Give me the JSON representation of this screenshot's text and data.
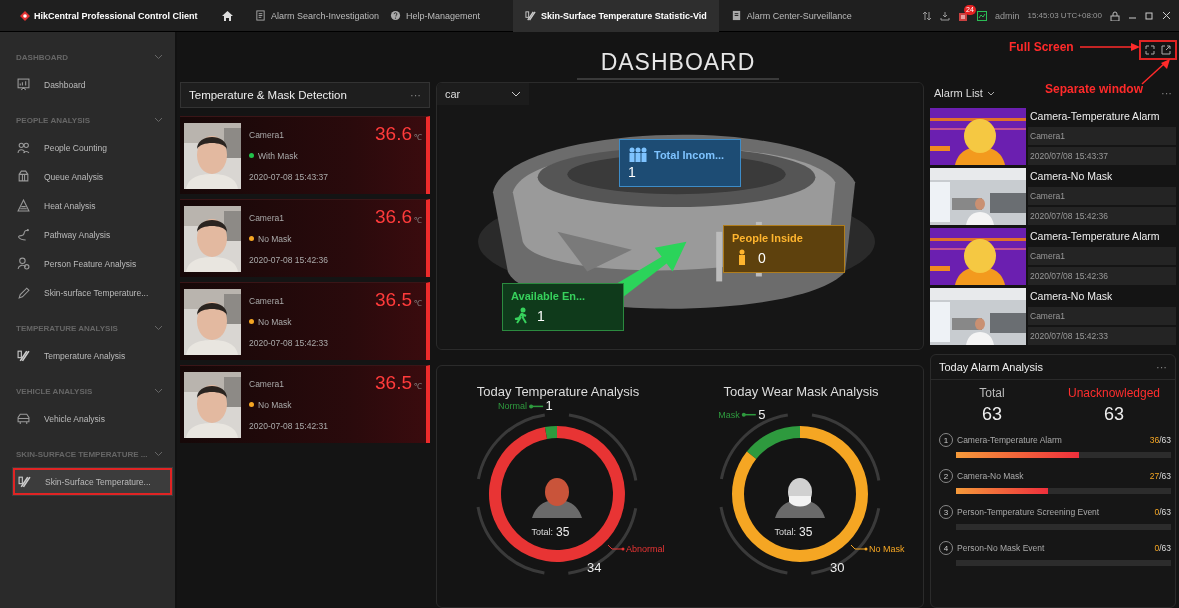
{
  "title_bar": {
    "app_name": "HikCentral Professional Control Client",
    "tabs": [
      {
        "label": "Alarm Search-Investigation",
        "selected": false
      },
      {
        "label": "Help-Management",
        "selected": false
      },
      {
        "label": "Skin-Surface Temperature Statistic-Vid",
        "selected": true
      },
      {
        "label": "Alarm Center-Surveillance",
        "selected": false
      }
    ],
    "badge": "24",
    "user": "admin",
    "time": "15:45:03 UTC+08:00"
  },
  "sidebar": {
    "sections": [
      {
        "title": "DASHBOARD",
        "expanded": true,
        "items": [
          {
            "label": "Dashboard",
            "selected": false
          }
        ]
      },
      {
        "title": "PEOPLE ANALYSIS",
        "expanded": true,
        "items": [
          {
            "label": "People Counting",
            "selected": false
          },
          {
            "label": "Queue Analysis",
            "selected": false
          },
          {
            "label": "Heat Analysis",
            "selected": false
          },
          {
            "label": "Pathway Analysis",
            "selected": false
          },
          {
            "label": "Person Feature Analysis",
            "selected": false
          },
          {
            "label": "Skin-surface Temperature...",
            "selected": false
          }
        ]
      },
      {
        "title": "TEMPERATURE ANALYSIS",
        "expanded": true,
        "items": [
          {
            "label": "Temperature Analysis",
            "selected": false
          }
        ]
      },
      {
        "title": "VEHICLE ANALYSIS",
        "expanded": true,
        "items": [
          {
            "label": "Vehicle Analysis",
            "selected": false
          }
        ]
      },
      {
        "title": "SKIN-SURFACE TEMPERATURE ...",
        "expanded": true,
        "items": [
          {
            "label": "Skin-Surface Temperature...",
            "selected": true
          }
        ]
      }
    ]
  },
  "dashboard": {
    "title": "DASHBOARD"
  },
  "annotations": [
    {
      "kind": "full_screen",
      "text": "Full Screen"
    },
    {
      "kind": "separate_window",
      "text": "Separate window"
    }
  ],
  "detection_panel": {
    "title": "Temperature & Mask Detection",
    "menu": "···",
    "records": [
      {
        "camera": "Camera1",
        "mask_status": "With Mask",
        "color": "#21c04a",
        "temperature": "36.6",
        "unit": "℃",
        "time": "2020-07-08 15:43:37"
      },
      {
        "camera": "Camera1",
        "mask_status": "No Mask",
        "color": "#f5a623",
        "temperature": "36.6",
        "unit": "℃",
        "time": "2020-07-08 15:42:36"
      },
      {
        "camera": "Camera1",
        "mask_status": "No Mask",
        "color": "#f5a623",
        "temperature": "36.5",
        "unit": "℃",
        "time": "2020-07-08 15:42:33"
      },
      {
        "camera": "Camera1",
        "mask_status": "No Mask",
        "color": "#f5a623",
        "temperature": "36.5",
        "unit": "℃",
        "time": "2020-07-08 15:42:31"
      }
    ]
  },
  "map_panel": {
    "selector": "car",
    "labels": [
      {
        "kind": "incoming",
        "title": "Total Incom...",
        "value": "1"
      },
      {
        "kind": "inside",
        "title": "People Inside",
        "value": "0"
      },
      {
        "kind": "entry",
        "title": "Available En...",
        "value": "1"
      }
    ]
  },
  "analysis_charts": [
    {
      "center_label": "Total:",
      "center_value": "35",
      "chart_data": {
        "type": "donut",
        "title": "Today Temperature Analysis",
        "data_labels": true,
        "categories": [
          "Normal",
          "Abnormal"
        ],
        "values": [
          1,
          34
        ],
        "colors": [
          "#2e9a3e",
          "#e83434"
        ]
      }
    },
    {
      "center_label": "Total:",
      "center_value": "35",
      "chart_data": {
        "type": "donut",
        "title": "Today Wear Mask Analysis",
        "data_labels": true,
        "categories": [
          "Mask",
          "No Mask"
        ],
        "values": [
          5,
          30
        ],
        "colors": [
          "#2e9a3e",
          "#f5a623"
        ]
      }
    }
  ],
  "alarm_list": {
    "title": "Alarm List",
    "menu": "···",
    "alarms": [
      {
        "title": "Camera-Temperature Alarm",
        "camera": "Camera1",
        "time": "2020/07/08 15:43:37",
        "kind": "thermal"
      },
      {
        "title": "Camera-No Mask",
        "camera": "Camera1",
        "time": "2020/07/08 15:42:36",
        "kind": "office"
      },
      {
        "title": "Camera-Temperature Alarm",
        "camera": "Camera1",
        "time": "2020/07/08 15:42:36",
        "kind": "thermal"
      },
      {
        "title": "Camera-No Mask",
        "camera": "Camera1",
        "time": "2020/07/08 15:42:33",
        "kind": "office"
      }
    ]
  },
  "alarm_analysis": {
    "title": "Today Alarm Analysis",
    "menu": "···",
    "total_label": "Total",
    "total": "63",
    "unack_label": "Unacknowledged",
    "unack": "63",
    "items": [
      {
        "index": "1",
        "name": "Camera-Temperature Alarm",
        "count": "36",
        "of": "/63",
        "level": 0.571
      },
      {
        "index": "2",
        "name": "Camera-No Mask",
        "count": "27",
        "of": "/63",
        "level": 0.429
      },
      {
        "index": "3",
        "name": "Person-Temperature Screening Event",
        "count": "0",
        "of": "/63",
        "level": 0
      },
      {
        "index": "4",
        "name": "Person-No Mask Event",
        "count": "0",
        "of": "/63",
        "level": 0
      }
    ]
  }
}
